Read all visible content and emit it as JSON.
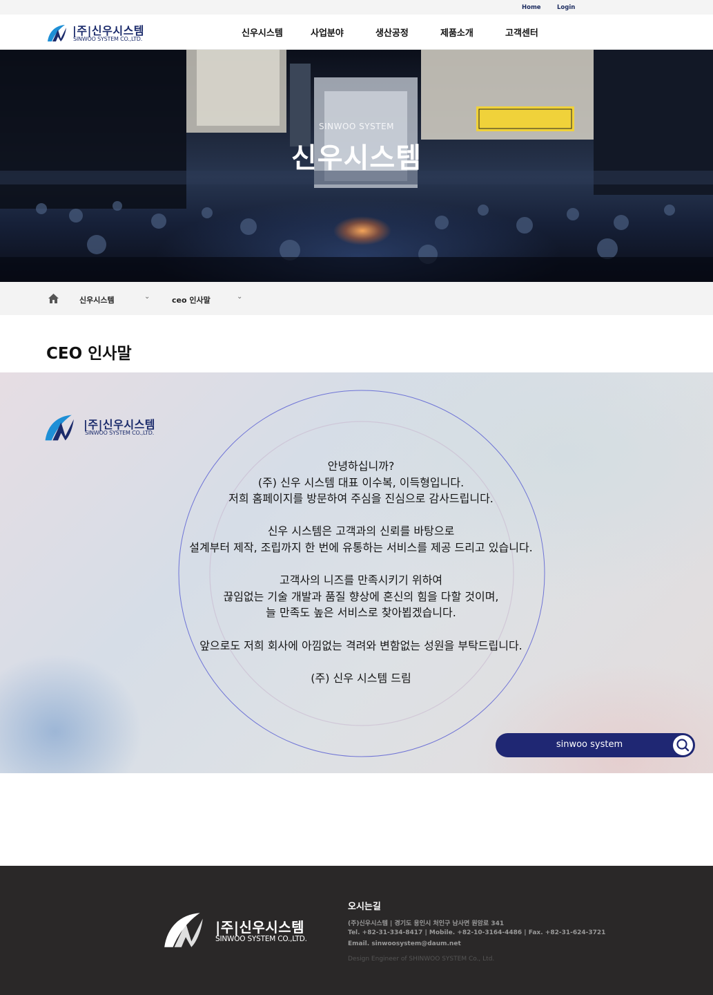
{
  "util": {
    "home": "Home",
    "login": "Login"
  },
  "logo": {
    "main": "|주|신우시스템",
    "sub": "SINWOO SYSTEM CO.,LTD."
  },
  "nav": [
    "신우시스템",
    "사업분야",
    "생산공정",
    "제품소개",
    "고객센터"
  ],
  "hero": {
    "subtitle": "SINWOO SYSTEM",
    "title": "신우시스템"
  },
  "breadcrumb": {
    "level1": "신우시스템",
    "level2": "ceo 인사말"
  },
  "page_title": "CEO 인사말",
  "message": {
    "p1": [
      "안녕하십니까?",
      "(주) 신우 시스템 대표 이수복, 이득형입니다.",
      "저희 홈페이지를 방문하여 주심을 진심으로 감사드립니다."
    ],
    "p2": [
      "신우 시스템은 고객과의 신뢰를 바탕으로",
      "설계부터 제작, 조립까지 한 번에 유통하는 서비스를 제공 드리고 있습니다."
    ],
    "p3": [
      "고객사의 니즈를 만족시키기 위하여",
      "끊임없는 기술 개발과 품질 향상에 혼신의 힘을 다할 것이며,",
      "늘 만족도 높은 서비스로 찾아뵙겠습니다."
    ],
    "p4": [
      "앞으로도 저희 회사에 아낌없는 격려와 변함없는 성원을 부탁드립니다."
    ],
    "p5": [
      "(주) 신우 시스템 드림"
    ]
  },
  "search": {
    "label": "sinwoo system"
  },
  "footer": {
    "title": "오시는길",
    "line1": "(주)신우시스템   |   경기도 용인시 처인구 남사면 원암로 341",
    "line2": "Tel. +82-31-334-8417   |   Mobile. +82-10-3164-4486   |   Fax. +82-31-624-3721",
    "line3": "Email. sinwoosystem@daum.net",
    "copyright": "Design Engineer of SHINWOO SYSTEM Co., Ltd."
  },
  "colors": {
    "brand_navy": "#1b2b6b",
    "brand_blue": "#1e8fd6",
    "pill": "#1f2773",
    "footer_bg": "#2a2828"
  }
}
